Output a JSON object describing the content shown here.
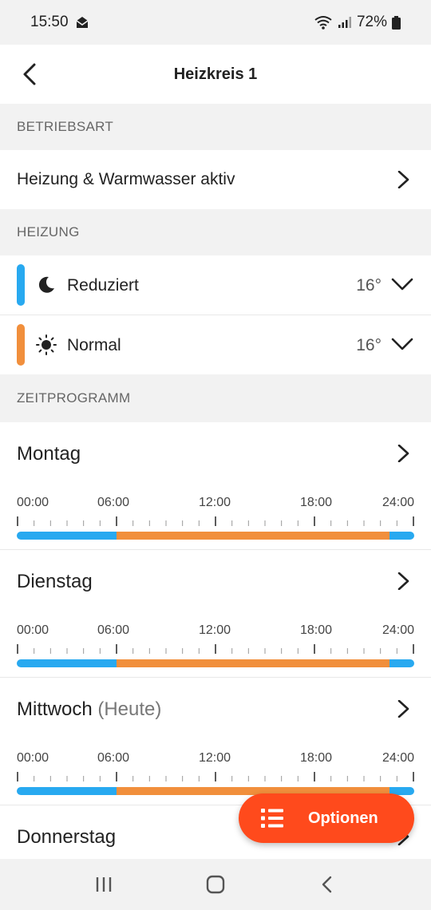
{
  "status": {
    "time": "15:50",
    "battery": "72%"
  },
  "header": {
    "title": "Heizkreis 1"
  },
  "sections": {
    "mode": "BETRIEBSART",
    "heating": "HEIZUNG",
    "schedule": "ZEITPROGRAMM"
  },
  "mode": {
    "value": "Heizung & Warmwasser aktiv"
  },
  "heating": [
    {
      "label": "Reduziert",
      "temp": "16°",
      "color": "#28a9f0",
      "icon": "moon-icon"
    },
    {
      "label": "Normal",
      "temp": "16°",
      "color": "#f18f3c",
      "icon": "sun-icon"
    }
  ],
  "tick_labels": [
    "00:00",
    "06:00",
    "12:00",
    "18:00",
    "24:00"
  ],
  "days": [
    {
      "name": "Montag",
      "suffix": "",
      "segments": [
        {
          "from": 0,
          "to": 6,
          "mode": "reduced"
        },
        {
          "from": 6,
          "to": 22.5,
          "mode": "normal"
        },
        {
          "from": 22.5,
          "to": 24,
          "mode": "reduced"
        }
      ]
    },
    {
      "name": "Dienstag",
      "suffix": "",
      "segments": [
        {
          "from": 0,
          "to": 6,
          "mode": "reduced"
        },
        {
          "from": 6,
          "to": 22.5,
          "mode": "normal"
        },
        {
          "from": 22.5,
          "to": 24,
          "mode": "reduced"
        }
      ]
    },
    {
      "name": "Mittwoch",
      "suffix": "(Heute)",
      "segments": [
        {
          "from": 0,
          "to": 6,
          "mode": "reduced"
        },
        {
          "from": 6,
          "to": 22.5,
          "mode": "normal"
        },
        {
          "from": 22.5,
          "to": 24,
          "mode": "reduced"
        }
      ]
    },
    {
      "name": "Donnerstag",
      "suffix": "",
      "segments": []
    }
  ],
  "colors": {
    "reduced": "#28a9f0",
    "normal": "#f18f3c",
    "accent": "#ff4a1c"
  },
  "fab": {
    "label": "Optionen",
    "icon": "list-icon"
  }
}
